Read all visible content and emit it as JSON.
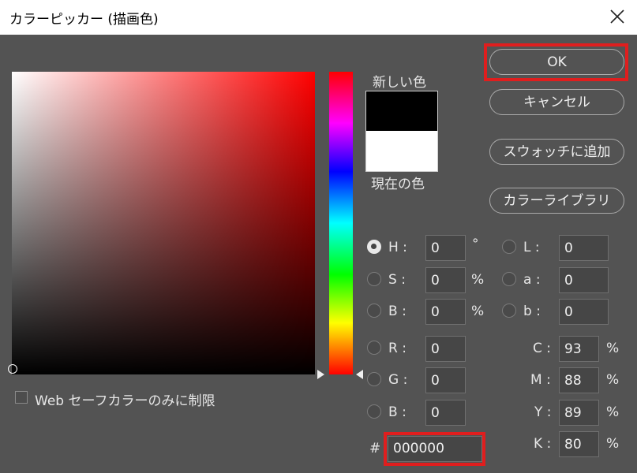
{
  "dialog": {
    "title": "カラーピッカー (描画色)"
  },
  "swatches": {
    "new_label": "新しい色",
    "current_label": "現在の色",
    "new_color": "#000000",
    "current_color": "#ffffff"
  },
  "buttons": {
    "ok": "OK",
    "cancel": "キャンセル",
    "add_swatch": "スウォッチに追加",
    "library": "カラーライブラリ"
  },
  "hsb": {
    "h": {
      "label": "H :",
      "value": "0",
      "unit": "°"
    },
    "s": {
      "label": "S :",
      "value": "0",
      "unit": "%"
    },
    "b": {
      "label": "B :",
      "value": "0",
      "unit": "%"
    }
  },
  "lab": {
    "l": {
      "label": "L :",
      "value": "0"
    },
    "a": {
      "label": "a :",
      "value": "0"
    },
    "b": {
      "label": "b :",
      "value": "0"
    }
  },
  "rgb": {
    "r": {
      "label": "R :",
      "value": "0"
    },
    "g": {
      "label": "G :",
      "value": "0"
    },
    "b": {
      "label": "B :",
      "value": "0"
    }
  },
  "cmyk": {
    "c": {
      "label": "C :",
      "value": "93",
      "unit": "%"
    },
    "m": {
      "label": "M :",
      "value": "88",
      "unit": "%"
    },
    "y": {
      "label": "Y :",
      "value": "89",
      "unit": "%"
    },
    "k": {
      "label": "K :",
      "value": "80",
      "unit": "%"
    }
  },
  "hex": {
    "label": "#",
    "value": "000000"
  },
  "web_safe": {
    "label": "Web セーフカラーのみに制限",
    "checked": false
  },
  "accent": {
    "highlight": "#e01e1e"
  },
  "icons": {
    "close": "close-icon"
  }
}
